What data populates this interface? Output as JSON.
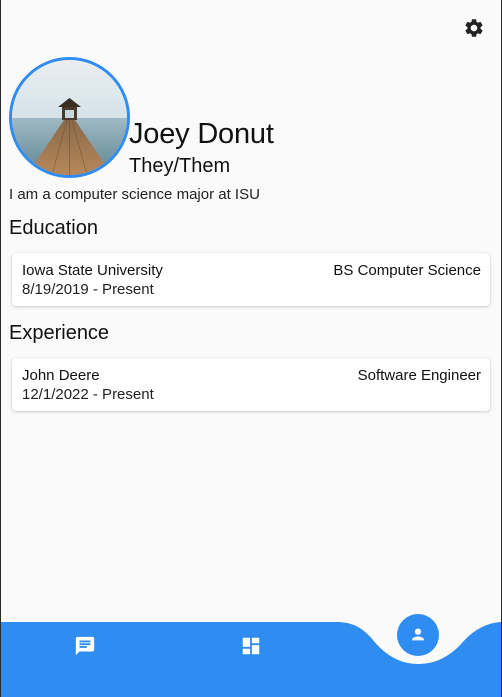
{
  "profile": {
    "name": "Joey Donut",
    "pronouns": "They/Them",
    "bio": "I am a computer science major at ISU"
  },
  "education": {
    "title": "Education",
    "items": [
      {
        "org": "Iowa State University",
        "role": "BS Computer Science",
        "dates": "8/19/2019 - Present"
      }
    ]
  },
  "experience": {
    "title": "Experience",
    "items": [
      {
        "org": "John Deere",
        "role": "Software Engineer",
        "dates": "12/1/2022 - Present"
      }
    ]
  },
  "icons": {
    "settings": "gear-icon",
    "nav_chat": "chat-icon",
    "nav_dashboard": "dashboard-icon",
    "nav_profile": "person-icon"
  },
  "colors": {
    "accent": "#2f8cf0",
    "background": "#fafafa",
    "card": "#ffffff"
  }
}
